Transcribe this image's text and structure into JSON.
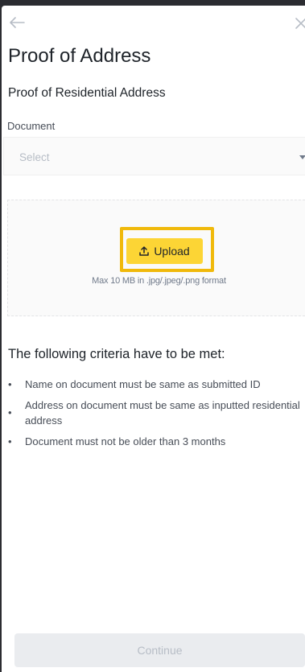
{
  "header": {
    "back_icon": "arrow-left-icon",
    "close_icon": "close-icon",
    "title": "Proof of Address"
  },
  "section": {
    "title": "Proof of Residential Address"
  },
  "document_field": {
    "label": "Document",
    "placeholder": "Select",
    "caret_icon": "caret-down-icon"
  },
  "upload": {
    "button_label": "Upload",
    "button_icon": "upload-icon",
    "hint": "Max 10 MB in .jpg/.jpeg/.png format"
  },
  "criteria": {
    "title": "The following criteria have to be met:",
    "items": [
      "Name on document must be same as submitted ID",
      "Address on document must be same as inputted residential address",
      "Document must not be older than 3 months"
    ]
  },
  "footer": {
    "continue_label": "Continue"
  },
  "colors": {
    "backdrop": "#2b2c31",
    "accent_yellow": "#fcd535",
    "highlight_border": "#f0b90b",
    "disabled_button": "#eaecef"
  }
}
